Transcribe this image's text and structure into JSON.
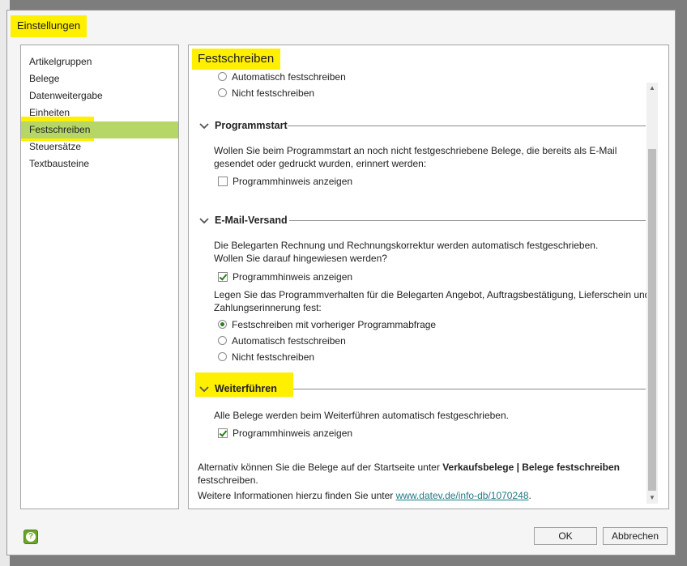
{
  "dialog": {
    "title": "Einstellungen"
  },
  "nav": {
    "items": [
      "Artikelgruppen",
      "Belege",
      "Datenweitergabe",
      "Einheiten",
      "Festschreiben",
      "Steuersätze",
      "Textbausteine"
    ],
    "selected": "Festschreiben"
  },
  "content": {
    "title": "Festschreiben",
    "top_options": [
      {
        "label": "Automatisch festschreiben",
        "selected": false
      },
      {
        "label": "Nicht festschreiben",
        "selected": false
      }
    ],
    "programmstart": {
      "heading": "Programmstart",
      "text_line1": "Wollen Sie beim Programmstart an noch nicht festgeschriebene Belege, die bereits als E-Mail",
      "text_line2": "gesendet oder gedruckt wurden, erinnert werden:",
      "checkbox_label": "Programmhinweis anzeigen",
      "checked": false
    },
    "email_versand": {
      "heading": "E-Mail-Versand",
      "text1_line1": "Die Belegarten Rechnung und Rechnungskorrektur werden automatisch festgeschrieben.",
      "text1_line2": "Wollen Sie darauf hingewiesen werden?",
      "checkbox_label": "Programmhinweis anzeigen",
      "checked": true,
      "text2_line1": "Legen Sie das Programmverhalten für die Belegarten Angebot, Auftragsbestätigung, Lieferschein und",
      "text2_line2": "Zahlungserinnerung fest:",
      "options": [
        {
          "label": "Festschreiben mit vorheriger Programmabfrage",
          "selected": true
        },
        {
          "label": "Automatisch festschreiben",
          "selected": false
        },
        {
          "label": "Nicht festschreiben",
          "selected": false
        }
      ]
    },
    "weiterfuehren": {
      "heading": "Weiterführen",
      "text": "Alle Belege werden beim Weiterführen automatisch festgeschrieben.",
      "checkbox_label": "Programmhinweis anzeigen",
      "checked": true
    },
    "footer": {
      "line1_prefix": "Alternativ können Sie die Belege auf der Startseite unter ",
      "line1_bold": "Verkaufsbelege | Belege festschreiben",
      "line2": "festschreiben.",
      "line3_prefix": "Weitere Informationen hierzu finden Sie unter ",
      "link_text": "www.datev.de/info-db/1070248",
      "line3_suffix": "."
    }
  },
  "buttons": {
    "ok": "OK",
    "cancel": "Abbrechen"
  },
  "icons": {
    "help": "help-icon",
    "chevron": "chevron-down-icon"
  },
  "colors": {
    "highlight": "#ffef00",
    "selection": "#b6d767",
    "accent_green": "#2e7d20",
    "link": "#1c7a83"
  }
}
